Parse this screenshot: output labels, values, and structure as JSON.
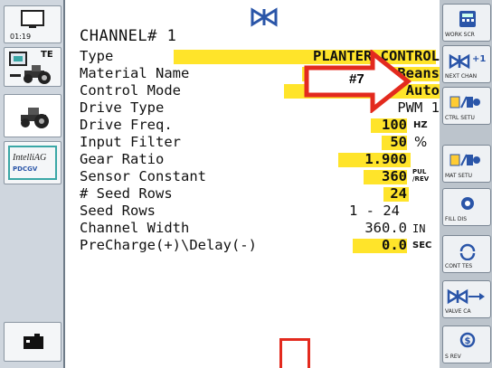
{
  "sidebar": {
    "clock": "01:19",
    "te_label": "TE",
    "intellag_label": "IntelliAG",
    "pdcgv_label": "PDCGV"
  },
  "header": {
    "title": "CHANNEL# 1"
  },
  "rows": [
    {
      "label": "Type",
      "value": "PLANTER CONTROL",
      "unit": ""
    },
    {
      "label": "Material Name",
      "value": "Beans",
      "unit": ""
    },
    {
      "label": "Control Mode",
      "value": "Auto",
      "unit": ""
    },
    {
      "label": "Drive Type",
      "value": "PWM 1",
      "unit": ""
    },
    {
      "label": "Drive Freq.",
      "value": "100",
      "unit": "HZ"
    },
    {
      "label": "Input Filter",
      "value": "50",
      "unit": "%"
    },
    {
      "label": "Gear Ratio",
      "value": "1.900",
      "unit": ""
    },
    {
      "label": "Sensor Constant",
      "value": "360",
      "unit_top": "PUL",
      "unit_bottom": "/REV"
    },
    {
      "label": "# Seed Rows",
      "value": "24",
      "unit": ""
    },
    {
      "label": "Seed Rows",
      "value": "1 - 24",
      "unit": ""
    },
    {
      "label": "Channel Width",
      "value": "360.0",
      "unit": "IN"
    },
    {
      "label": "PreCharge(+)\\Delay(-)",
      "value": "0.0",
      "unit": "SEC"
    }
  ],
  "annotation": {
    "badge": "#7"
  },
  "toolbar": {
    "work_screen": "WORK SCR",
    "next_channel": "NEXT CHAN",
    "next_channel_top": "+1",
    "ctrl_setup": "CTRL SETU",
    "mat_setup": "MAT SETU",
    "fill_dist": "FILL DIS",
    "cont_test": "CONT TES",
    "valve_cal": "VALVE CA",
    "s_rev": "S REV"
  },
  "colors": {
    "highlight": "#ffe42a",
    "accent_red": "#e32a1e",
    "toolbar_icon": "#2a55a8"
  }
}
